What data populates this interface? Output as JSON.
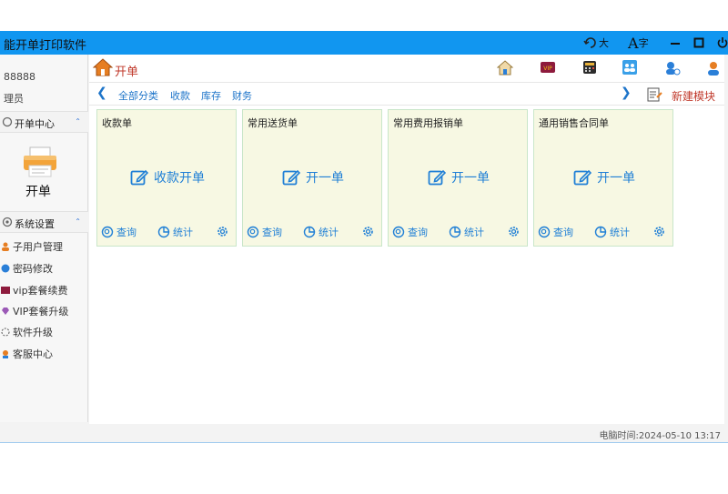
{
  "titlebar": {
    "title": "能开单打印软件",
    "font_big_label": "大",
    "font_char_label": "字"
  },
  "sidebar": {
    "user_id": "88888",
    "user_role": "理员",
    "section1": "开单中心",
    "kaidan_label": "开单",
    "section2": "系统设置",
    "items": [
      {
        "label": "子用户管理",
        "icon": "user-icon"
      },
      {
        "label": "密码修改",
        "icon": "key-icon"
      },
      {
        "label": "vip套餐续费",
        "icon": "vip-icon"
      },
      {
        "label": "VIP套餐升级",
        "icon": "diamond-icon"
      },
      {
        "label": "软件升级",
        "icon": "upgrade-icon"
      },
      {
        "label": "客服中心",
        "icon": "support-icon"
      }
    ]
  },
  "main": {
    "page_title": "开单",
    "categories": [
      "全部分类",
      "收款",
      "库存",
      "财务"
    ],
    "new_module": "新建模块",
    "cards": [
      {
        "title": "收款单",
        "action": "收款开单",
        "query": "查询",
        "stats": "统计"
      },
      {
        "title": "常用送货单",
        "action": "开一单",
        "query": "查询",
        "stats": "统计"
      },
      {
        "title": "常用费用报销单",
        "action": "开一单",
        "query": "查询",
        "stats": "统计"
      },
      {
        "title": "通用销售合同单",
        "action": "开一单",
        "query": "查询",
        "stats": "统计"
      }
    ]
  },
  "status": {
    "time": "电脑时间:2024-05-10 13:17"
  },
  "colors": {
    "titlebar": "#1196f0",
    "accent_red": "#c0392b",
    "link_blue": "#1f7fd6",
    "card_bg": "#f7f8e3"
  }
}
